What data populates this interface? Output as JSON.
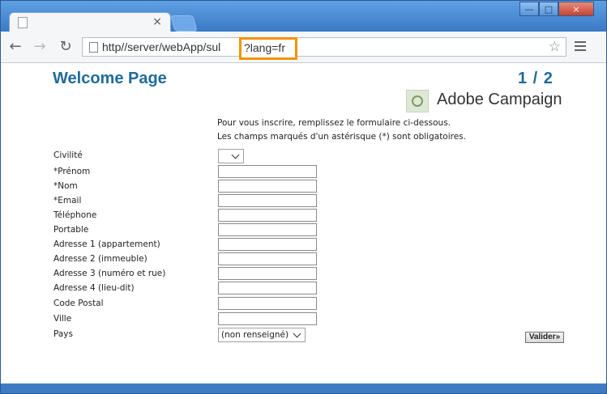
{
  "browser": {
    "url_main": "http//server/webApp/sul",
    "url_param": "?lang=fr",
    "icons": {
      "back": "back-arrow-icon",
      "forward": "forward-arrow-icon",
      "reload": "reload-icon",
      "bookmark": "star-icon",
      "menu": "hamburger-menu-icon"
    },
    "highlight_color": "#f29400"
  },
  "page": {
    "title": "Welcome Page",
    "step": "1 / 2",
    "brand": "Adobe Campaign",
    "intro_line1": "Pour vous inscrire, remplissez le formulaire ci-dessous.",
    "intro_line2": "Les champs marqués d'un astérisque (*) sont obligatoires.",
    "accent_color": "#1f6b9a"
  },
  "form": {
    "fields": [
      {
        "label": "Civilité",
        "type": "select",
        "value": ""
      },
      {
        "label": "*Prénom",
        "type": "text",
        "value": ""
      },
      {
        "label": "*Nom",
        "type": "text",
        "value": ""
      },
      {
        "label": "*Email",
        "type": "text",
        "value": ""
      },
      {
        "label": "Téléphone",
        "type": "text",
        "value": ""
      },
      {
        "label": "Portable",
        "type": "text",
        "value": ""
      },
      {
        "label": "Adresse 1 (appartement)",
        "type": "text",
        "value": ""
      },
      {
        "label": "Adresse 2 (immeuble)",
        "type": "text",
        "value": ""
      },
      {
        "label": "Adresse 3 (numéro et rue)",
        "type": "text",
        "value": ""
      },
      {
        "label": "Adresse 4 (lieu-dit)",
        "type": "text",
        "value": ""
      },
      {
        "label": "Code Postal",
        "type": "text",
        "value": ""
      },
      {
        "label": "Ville",
        "type": "text",
        "value": ""
      },
      {
        "label": "Pays",
        "type": "select",
        "value": "(non renseigné)"
      }
    ],
    "submit_label": "Valider»"
  }
}
